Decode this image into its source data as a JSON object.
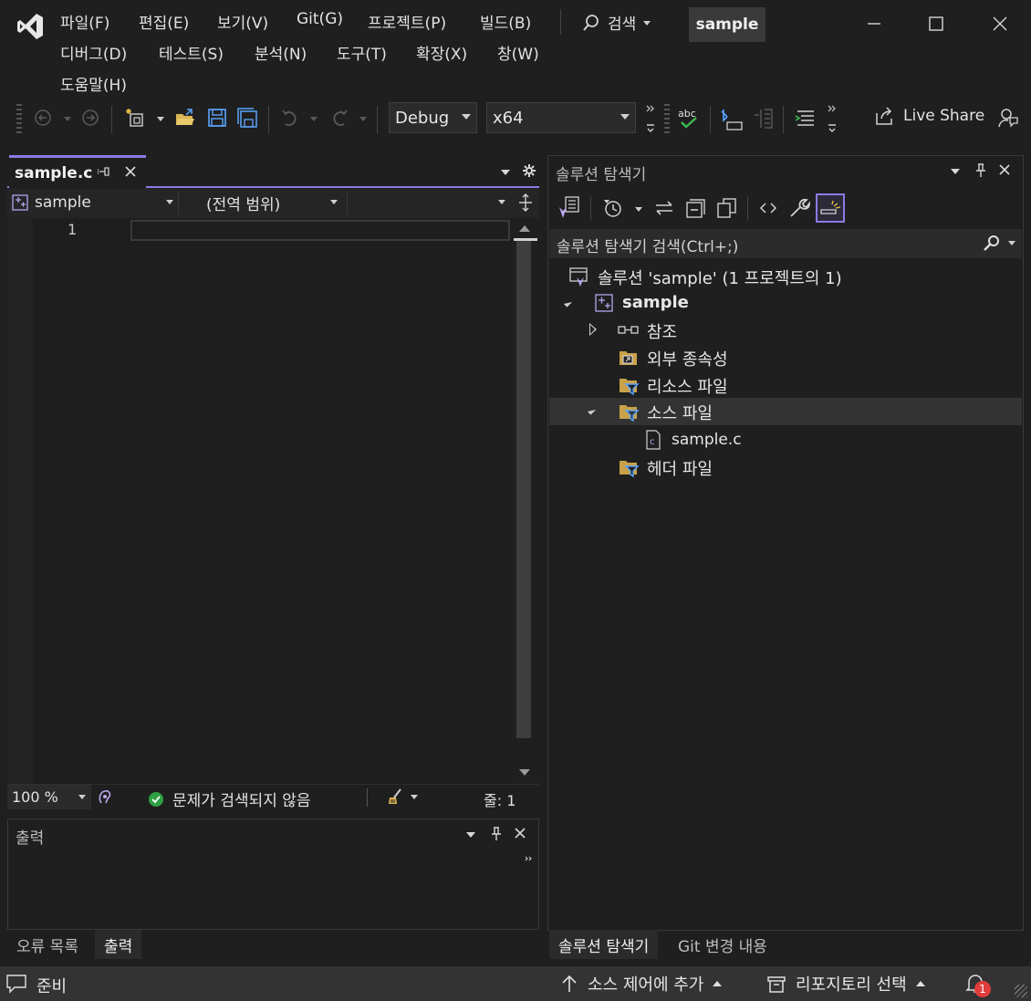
{
  "menu": {
    "row1": [
      "파일(F)",
      "편집(E)",
      "보기(V)",
      "Git(G)",
      "프로젝트(P)",
      "빌드(B)"
    ],
    "row2": [
      "디버그(D)",
      "테스트(S)",
      "분석(N)",
      "도구(T)",
      "확장(X)",
      "창(W)"
    ],
    "row3": [
      "도움말(H)"
    ],
    "search_label": "검색",
    "solution_title": "sample"
  },
  "toolbar": {
    "config": "Debug",
    "platform": "x64",
    "live_share": "Live Share"
  },
  "editor": {
    "tab_title": "sample.c",
    "nav_project": "sample",
    "nav_scope": "(전역 범위)",
    "line_number": "1",
    "zoom": "100 %",
    "issues": "문제가 검색되지 않음",
    "line_info": "줄: 1"
  },
  "output": {
    "title": "출력",
    "tabs": [
      "오류 목록",
      "출력"
    ]
  },
  "solution_explorer": {
    "title": "솔루션 탐색기",
    "search_placeholder": "솔루션 탐색기 검색(Ctrl+;)",
    "solution_node": "솔루션 'sample' (1 프로젝트의 1)",
    "project_node": "sample",
    "references": "참조",
    "external_deps": "외부 종속성",
    "resource_files": "리소스 파일",
    "source_files": "소스 파일",
    "source_file": "sample.c",
    "header_files": "헤더 파일",
    "tabs": [
      "솔루션 탐색기",
      "Git 변경 내용"
    ]
  },
  "statusbar": {
    "ready": "준비",
    "source_control": "소스 제어에 추가",
    "repository": "리포지토리 선택",
    "notification_count": "1"
  },
  "colors": {
    "accent": "#8c7ae6",
    "background": "#1f1f1f",
    "status_bar": "#333333",
    "ok_green": "#2ea043",
    "badge_red": "#e03c3c"
  }
}
